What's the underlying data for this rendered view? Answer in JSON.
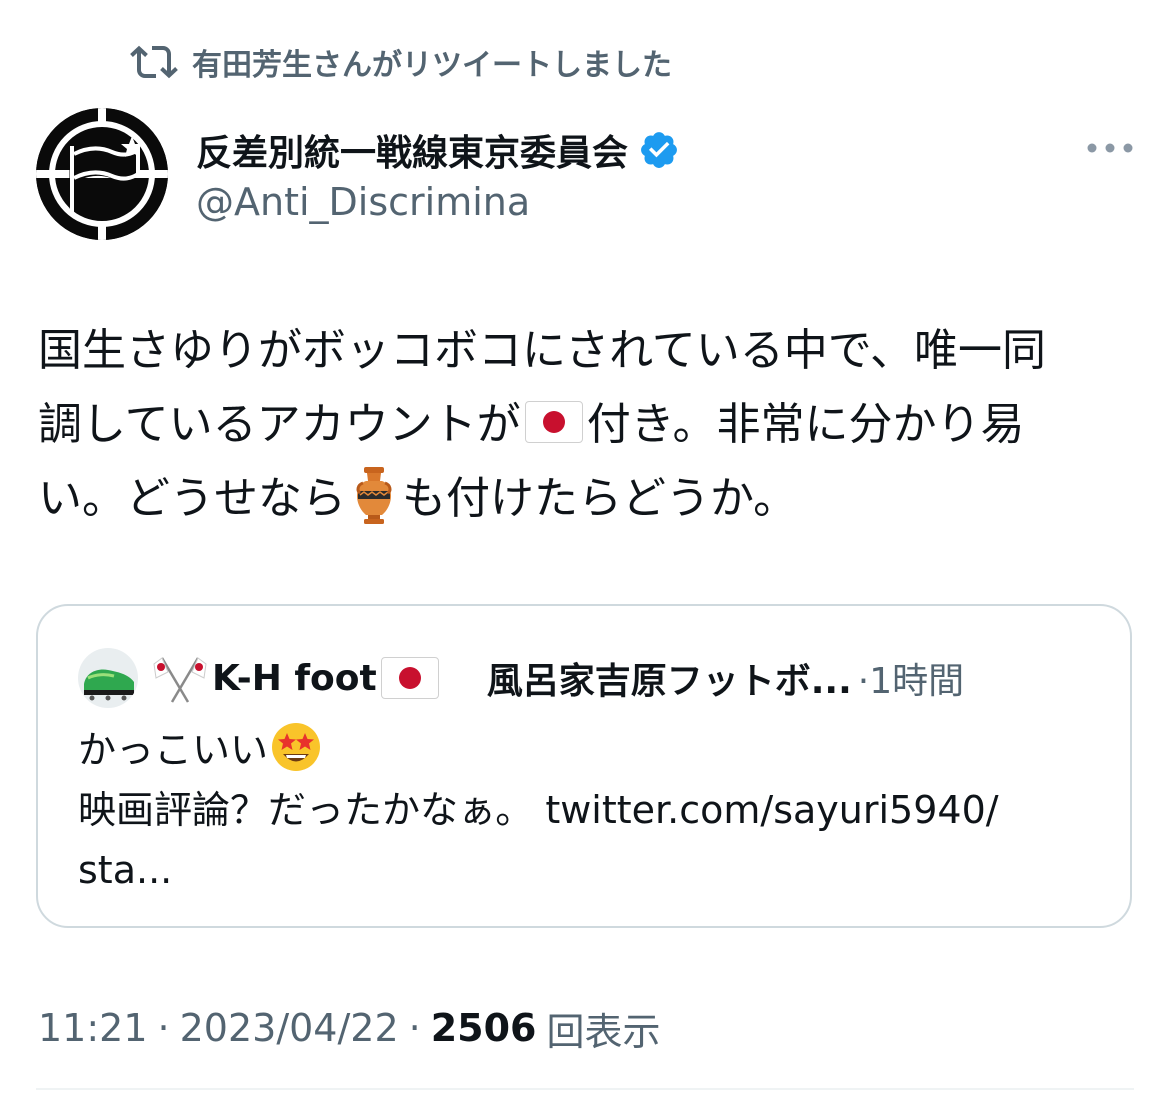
{
  "retweet": {
    "label": "有田芳生さんがリツイートしました",
    "icon": "retweet-icon"
  },
  "author": {
    "display_name": "反差別統一戦線東京委員会",
    "handle": "@Anti_Discrimina",
    "verified": true,
    "verified_color": "#1d9bf0"
  },
  "tweet": {
    "lines": [
      {
        "text": "国生さゆりがボッコボコにされている中で、唯一同"
      },
      {
        "before": "調しているアカウントが",
        "emoji": "flag-japan",
        "after": "付き。非常に分かり易"
      },
      {
        "before": "い。どうせなら",
        "emoji": "amphora",
        "after": "も付けたらどうか。"
      }
    ]
  },
  "quote": {
    "name": "K-H foot",
    "handle": "風呂家吉原フットボ...",
    "time": "·1時間",
    "body_line1": "かっこいい",
    "body_line2": "映画評論？だったかなぁ。 twitter.com/sayuri5940/",
    "body_line3": "sta..."
  },
  "meta": {
    "time": "11:21",
    "sep1": "·",
    "date": "2023/04/22",
    "sep2": "·",
    "views_count": "2506",
    "views_label": "回表示"
  },
  "colors": {
    "secondary_text": "#536471",
    "primary_text": "#0f1419",
    "border": "#cfd9de"
  }
}
